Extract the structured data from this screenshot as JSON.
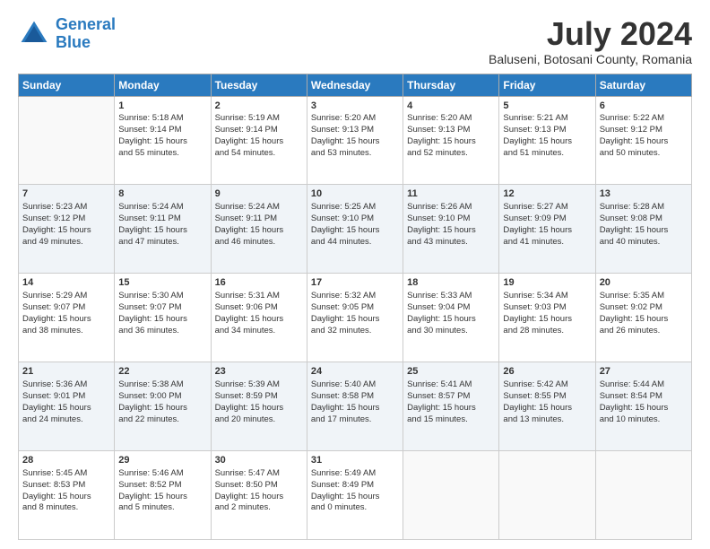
{
  "logo": {
    "line1": "General",
    "line2": "Blue"
  },
  "title": "July 2024",
  "subtitle": "Baluseni, Botosani County, Romania",
  "days": [
    "Sunday",
    "Monday",
    "Tuesday",
    "Wednesday",
    "Thursday",
    "Friday",
    "Saturday"
  ],
  "weeks": [
    [
      {
        "num": "",
        "lines": []
      },
      {
        "num": "1",
        "lines": [
          "Sunrise: 5:18 AM",
          "Sunset: 9:14 PM",
          "Daylight: 15 hours",
          "and 55 minutes."
        ]
      },
      {
        "num": "2",
        "lines": [
          "Sunrise: 5:19 AM",
          "Sunset: 9:14 PM",
          "Daylight: 15 hours",
          "and 54 minutes."
        ]
      },
      {
        "num": "3",
        "lines": [
          "Sunrise: 5:20 AM",
          "Sunset: 9:13 PM",
          "Daylight: 15 hours",
          "and 53 minutes."
        ]
      },
      {
        "num": "4",
        "lines": [
          "Sunrise: 5:20 AM",
          "Sunset: 9:13 PM",
          "Daylight: 15 hours",
          "and 52 minutes."
        ]
      },
      {
        "num": "5",
        "lines": [
          "Sunrise: 5:21 AM",
          "Sunset: 9:13 PM",
          "Daylight: 15 hours",
          "and 51 minutes."
        ]
      },
      {
        "num": "6",
        "lines": [
          "Sunrise: 5:22 AM",
          "Sunset: 9:12 PM",
          "Daylight: 15 hours",
          "and 50 minutes."
        ]
      }
    ],
    [
      {
        "num": "7",
        "lines": [
          "Sunrise: 5:23 AM",
          "Sunset: 9:12 PM",
          "Daylight: 15 hours",
          "and 49 minutes."
        ]
      },
      {
        "num": "8",
        "lines": [
          "Sunrise: 5:24 AM",
          "Sunset: 9:11 PM",
          "Daylight: 15 hours",
          "and 47 minutes."
        ]
      },
      {
        "num": "9",
        "lines": [
          "Sunrise: 5:24 AM",
          "Sunset: 9:11 PM",
          "Daylight: 15 hours",
          "and 46 minutes."
        ]
      },
      {
        "num": "10",
        "lines": [
          "Sunrise: 5:25 AM",
          "Sunset: 9:10 PM",
          "Daylight: 15 hours",
          "and 44 minutes."
        ]
      },
      {
        "num": "11",
        "lines": [
          "Sunrise: 5:26 AM",
          "Sunset: 9:10 PM",
          "Daylight: 15 hours",
          "and 43 minutes."
        ]
      },
      {
        "num": "12",
        "lines": [
          "Sunrise: 5:27 AM",
          "Sunset: 9:09 PM",
          "Daylight: 15 hours",
          "and 41 minutes."
        ]
      },
      {
        "num": "13",
        "lines": [
          "Sunrise: 5:28 AM",
          "Sunset: 9:08 PM",
          "Daylight: 15 hours",
          "and 40 minutes."
        ]
      }
    ],
    [
      {
        "num": "14",
        "lines": [
          "Sunrise: 5:29 AM",
          "Sunset: 9:07 PM",
          "Daylight: 15 hours",
          "and 38 minutes."
        ]
      },
      {
        "num": "15",
        "lines": [
          "Sunrise: 5:30 AM",
          "Sunset: 9:07 PM",
          "Daylight: 15 hours",
          "and 36 minutes."
        ]
      },
      {
        "num": "16",
        "lines": [
          "Sunrise: 5:31 AM",
          "Sunset: 9:06 PM",
          "Daylight: 15 hours",
          "and 34 minutes."
        ]
      },
      {
        "num": "17",
        "lines": [
          "Sunrise: 5:32 AM",
          "Sunset: 9:05 PM",
          "Daylight: 15 hours",
          "and 32 minutes."
        ]
      },
      {
        "num": "18",
        "lines": [
          "Sunrise: 5:33 AM",
          "Sunset: 9:04 PM",
          "Daylight: 15 hours",
          "and 30 minutes."
        ]
      },
      {
        "num": "19",
        "lines": [
          "Sunrise: 5:34 AM",
          "Sunset: 9:03 PM",
          "Daylight: 15 hours",
          "and 28 minutes."
        ]
      },
      {
        "num": "20",
        "lines": [
          "Sunrise: 5:35 AM",
          "Sunset: 9:02 PM",
          "Daylight: 15 hours",
          "and 26 minutes."
        ]
      }
    ],
    [
      {
        "num": "21",
        "lines": [
          "Sunrise: 5:36 AM",
          "Sunset: 9:01 PM",
          "Daylight: 15 hours",
          "and 24 minutes."
        ]
      },
      {
        "num": "22",
        "lines": [
          "Sunrise: 5:38 AM",
          "Sunset: 9:00 PM",
          "Daylight: 15 hours",
          "and 22 minutes."
        ]
      },
      {
        "num": "23",
        "lines": [
          "Sunrise: 5:39 AM",
          "Sunset: 8:59 PM",
          "Daylight: 15 hours",
          "and 20 minutes."
        ]
      },
      {
        "num": "24",
        "lines": [
          "Sunrise: 5:40 AM",
          "Sunset: 8:58 PM",
          "Daylight: 15 hours",
          "and 17 minutes."
        ]
      },
      {
        "num": "25",
        "lines": [
          "Sunrise: 5:41 AM",
          "Sunset: 8:57 PM",
          "Daylight: 15 hours",
          "and 15 minutes."
        ]
      },
      {
        "num": "26",
        "lines": [
          "Sunrise: 5:42 AM",
          "Sunset: 8:55 PM",
          "Daylight: 15 hours",
          "and 13 minutes."
        ]
      },
      {
        "num": "27",
        "lines": [
          "Sunrise: 5:44 AM",
          "Sunset: 8:54 PM",
          "Daylight: 15 hours",
          "and 10 minutes."
        ]
      }
    ],
    [
      {
        "num": "28",
        "lines": [
          "Sunrise: 5:45 AM",
          "Sunset: 8:53 PM",
          "Daylight: 15 hours",
          "and 8 minutes."
        ]
      },
      {
        "num": "29",
        "lines": [
          "Sunrise: 5:46 AM",
          "Sunset: 8:52 PM",
          "Daylight: 15 hours",
          "and 5 minutes."
        ]
      },
      {
        "num": "30",
        "lines": [
          "Sunrise: 5:47 AM",
          "Sunset: 8:50 PM",
          "Daylight: 15 hours",
          "and 2 minutes."
        ]
      },
      {
        "num": "31",
        "lines": [
          "Sunrise: 5:49 AM",
          "Sunset: 8:49 PM",
          "Daylight: 15 hours",
          "and 0 minutes."
        ]
      },
      {
        "num": "",
        "lines": []
      },
      {
        "num": "",
        "lines": []
      },
      {
        "num": "",
        "lines": []
      }
    ]
  ]
}
